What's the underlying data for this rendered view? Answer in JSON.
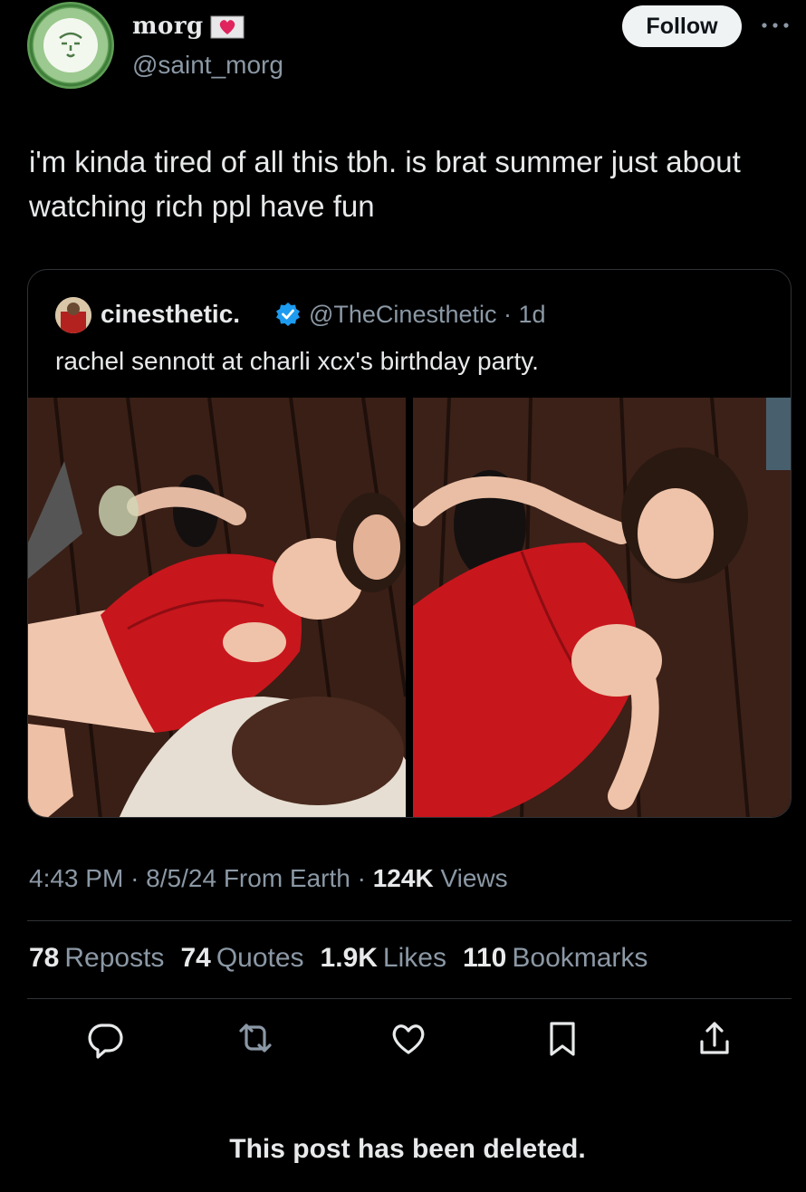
{
  "author": {
    "display_name": "morg",
    "badge_icon": "heart-envelope-icon",
    "handle": "@saint_morg"
  },
  "follow_label": "Follow",
  "more_icon": "more-dots-icon",
  "tweet_text": "i'm kinda tired of all this tbh. is brat summer just about watching rich ppl have fun",
  "quoted_post": {
    "name": "cinesthetic.",
    "verified_icon": "verified-badge-icon",
    "handle": "@TheCinesthetic",
    "separator": "·",
    "age": "1d",
    "text": "rachel sennott at charli xcx's birthday party.",
    "photos": [
      "party-photo-1",
      "party-photo-2"
    ]
  },
  "meta": {
    "time": "4:43 PM",
    "date": "8/5/24",
    "source": "From Earth",
    "views_count": "124K",
    "views_label": "Views"
  },
  "stats": [
    {
      "count": "78",
      "label": "Reposts"
    },
    {
      "count": "74",
      "label": "Quotes"
    },
    {
      "count": "1.9K",
      "label": "Likes"
    },
    {
      "count": "110",
      "label": "Bookmarks"
    }
  ],
  "actions": [
    "reply-icon",
    "repost-icon",
    "like-icon",
    "bookmark-icon",
    "share-icon"
  ],
  "deleted_notice": "This post has been deleted.",
  "colors": {
    "background": "#000000",
    "text": "#e7e9ea",
    "muted": "#8b98a5",
    "border": "#2f3336",
    "verified": "#1d9bf0",
    "dress": "#c8161d"
  }
}
